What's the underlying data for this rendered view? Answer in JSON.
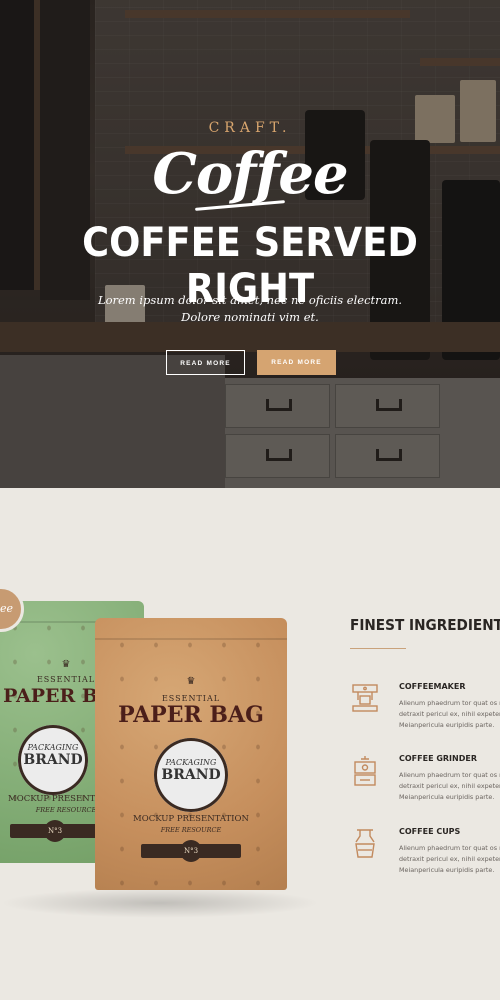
{
  "hero": {
    "craft_label": "CRAFT.",
    "script_title": "Coffee",
    "title": "COFFEE SERVED RIGHT",
    "subtitle_line1": "Lorem ipsum dolor sit amet, nec ne oficiis electram.",
    "subtitle_line2": "Dolore nominati vim et.",
    "buttons": [
      {
        "label": "READ MORE",
        "style": "outline"
      },
      {
        "label": "READ MORE",
        "style": "filled"
      }
    ],
    "accent_color": "#d5a471"
  },
  "products": {
    "green_pack": {
      "badge": "ee",
      "essential": "ESSENTIAL",
      "title": "PAPER BAG",
      "seal_line1": "PACKAGING",
      "seal_line2": "BRAND",
      "mockup": "MOCKUP PRESENTATION",
      "free": "FREE RESOURCE",
      "number": "N°3"
    },
    "kraft_pack": {
      "essential": "ESSENTIAL",
      "title": "PAPER BAG",
      "seal_line1": "PACKAGING",
      "seal_line2": "BRAND",
      "mockup": "MOCKUP PRESENTATION",
      "free": "FREE RESOURCE",
      "number": "N°3"
    }
  },
  "features": {
    "heading": "FINEST INGREDIENTS",
    "items": [
      {
        "icon": "coffeemaker-icon",
        "title": "COFFEEMAKER",
        "line1": "Alienum phaedrum tor quat os ne",
        "line2": "detraxit pericul ex, nihil expetend",
        "line3": "Meianpericula euripidis parte."
      },
      {
        "icon": "coffee-grinder-icon",
        "title": "COFFEE GRINDER",
        "line1": "Alienum phaedrum tor quat os ne",
        "line2": "detraxit pericul ex, nihil expetend",
        "line3": "Meianpericula euripidis parte."
      },
      {
        "icon": "coffee-cups-icon",
        "title": "COFFEE CUPS",
        "line1": "Alienum phaedrum tor quat os ne",
        "line2": "detraxit pericul ex, nihil expetend",
        "line3": "Meianpericula euripidis parte."
      }
    ],
    "icon_color": "#c28a5e"
  }
}
